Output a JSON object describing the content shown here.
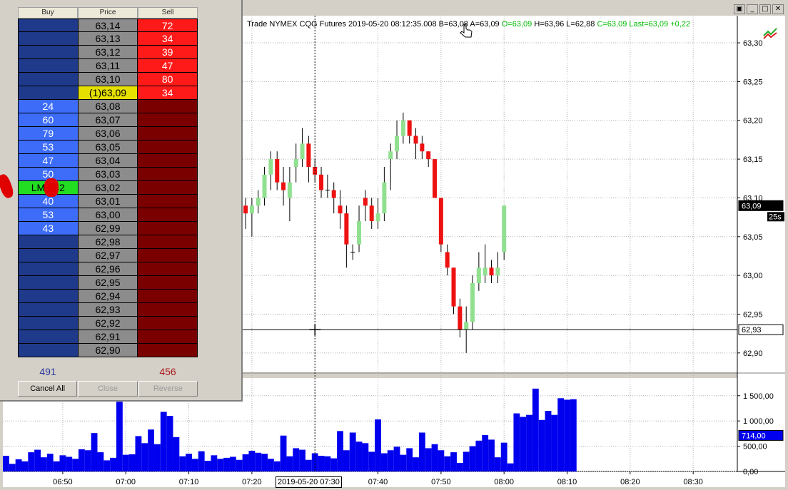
{
  "window": {
    "buttons": [
      {
        "name": "restore-icon",
        "glyph": "▣"
      },
      {
        "name": "minimize-icon",
        "glyph": "_"
      },
      {
        "name": "maximize-icon",
        "glyph": "□"
      },
      {
        "name": "close-icon",
        "glyph": "✕"
      }
    ]
  },
  "chart": {
    "info_prefix": "Trade  NYMEX  CQG  Futures  2019-05-20  08:12:35.008",
    "bid": "B=63,08",
    "ask": "A=63,09",
    "open": "O=63,09",
    "high": "H=63,96",
    "low": "L=62,88",
    "close": "C=63,09",
    "last": "Last=63,09",
    "change": "+0,22",
    "colors": {
      "up": "#90e090",
      "down": "#ee1111",
      "volume": "#0000ee",
      "label_bg": "#000000",
      "info_green": "#00bb00"
    },
    "price_ticks": [
      "63,30",
      "63,25",
      "63,20",
      "63,15",
      "63,10",
      "63,05",
      "63,00",
      "62,95",
      "62,90"
    ],
    "price_tick_values": [
      63.3,
      63.25,
      63.2,
      63.15,
      63.1,
      63.05,
      63.0,
      62.95,
      62.9
    ],
    "price_range": [
      62.875,
      63.335
    ],
    "last_label": "63,09",
    "last_value": 63.09,
    "timer_label": "25s",
    "cursor_label": "62,93",
    "cursor_value": 62.93,
    "volume_ticks": [
      "1 500,00",
      "1 000,00",
      "500,00",
      "0,00"
    ],
    "volume_tick_values": [
      1500,
      1000,
      500,
      0
    ],
    "volume_range": [
      0,
      1850
    ],
    "volume_label": "714,00",
    "volume_last": 714,
    "time_ticks": [
      "06:50",
      "07:00",
      "07:10",
      "07:20",
      "07:40",
      "07:50",
      "08:00",
      "08:10",
      "08:20",
      "08:30"
    ],
    "time_tick_minutes": [
      410,
      420,
      430,
      440,
      460,
      470,
      480,
      490,
      500,
      510
    ],
    "cursor_time_label": "2019-05-20 07:30",
    "cursor_time_minutes": 450,
    "time_range": [
      400.5,
      517
    ]
  },
  "chart_data": {
    "type": "bar",
    "x": [
      435,
      436,
      437,
      438,
      439,
      440,
      441,
      442,
      443,
      444,
      445,
      446,
      447,
      448,
      449,
      450,
      451,
      452,
      453,
      454,
      455,
      456,
      457,
      458,
      459,
      460,
      461,
      462,
      463,
      464,
      465,
      466,
      467,
      468,
      469,
      470,
      471,
      472,
      473,
      474,
      475,
      476,
      477,
      478,
      479,
      480,
      481,
      482,
      483,
      484,
      485,
      486,
      487,
      488,
      489,
      490,
      491
    ],
    "open": [
      63.14,
      63.2,
      63.12,
      63.1,
      63.09,
      63.08,
      63.09,
      63.1,
      63.13,
      63.15,
      63.12,
      63.1,
      63.14,
      63.15,
      63.17,
      63.14,
      63.13,
      63.11,
      63.11,
      63.09,
      63.08,
      63.03,
      63.04,
      63.1,
      63.09,
      63.07,
      63.08,
      63.15,
      63.16,
      63.18,
      63.2,
      63.18,
      63.17,
      63.16,
      63.15,
      63.1,
      63.03,
      63.01,
      62.96,
      62.93,
      62.94,
      62.99,
      63.0,
      63.01,
      63.0,
      63.03
    ],
    "close": [
      63.2,
      63.13,
      63.1,
      63.09,
      63.08,
      63.09,
      63.1,
      63.13,
      63.15,
      63.12,
      63.11,
      63.12,
      63.15,
      63.17,
      63.14,
      63.13,
      63.11,
      63.11,
      63.1,
      63.08,
      63.04,
      63.03,
      63.07,
      63.09,
      63.07,
      63.08,
      63.12,
      63.16,
      63.18,
      63.2,
      63.18,
      63.17,
      63.16,
      63.15,
      63.1,
      63.04,
      63.01,
      62.96,
      62.93,
      62.94,
      62.99,
      63.01,
      63.01,
      63.0,
      63.01,
      63.09
    ],
    "high": [
      63.23,
      63.23,
      63.14,
      63.12,
      63.1,
      63.1,
      63.11,
      63.14,
      63.16,
      63.16,
      63.14,
      63.14,
      63.17,
      63.19,
      63.18,
      63.15,
      63.14,
      63.13,
      63.12,
      63.11,
      63.09,
      63.04,
      63.09,
      63.11,
      63.1,
      63.1,
      63.14,
      63.17,
      63.2,
      63.21,
      63.2,
      63.19,
      63.18,
      63.16,
      63.15,
      63.1,
      63.04,
      63.01,
      62.97,
      62.96,
      63.0,
      63.03,
      63.04,
      63.02,
      63.03,
      63.09
    ],
    "low": [
      63.12,
      63.11,
      63.07,
      63.07,
      63.06,
      63.05,
      63.08,
      63.09,
      63.11,
      63.11,
      63.09,
      63.07,
      63.12,
      63.14,
      63.12,
      63.12,
      63.1,
      63.1,
      63.08,
      63.06,
      63.01,
      63.02,
      63.03,
      63.07,
      63.06,
      63.06,
      63.07,
      63.11,
      63.15,
      63.17,
      63.17,
      63.15,
      63.15,
      63.14,
      63.1,
      63.03,
      63.0,
      62.95,
      62.92,
      62.9,
      62.93,
      62.98,
      62.99,
      62.99,
      62.99,
      63.02
    ],
    "volume_x": [
      401,
      402,
      403,
      404,
      405,
      406,
      407,
      408,
      409,
      410,
      411,
      412,
      413,
      414,
      415,
      416,
      417,
      418,
      419,
      420,
      421,
      422,
      423,
      424,
      425,
      426,
      427,
      428,
      429,
      430,
      431,
      432,
      433,
      434,
      435,
      436,
      437,
      438,
      439,
      440,
      441,
      442,
      443,
      444,
      445,
      446,
      447,
      448,
      449,
      450,
      451,
      452,
      453,
      454,
      455,
      456,
      457,
      458,
      459,
      460,
      461,
      462,
      463,
      464,
      465,
      466,
      467,
      468,
      469,
      470,
      471,
      472,
      473,
      474,
      475,
      476,
      477,
      478,
      479,
      480,
      481,
      482,
      483,
      484,
      485,
      486,
      487,
      488,
      489,
      490,
      491
    ],
    "volume": [
      310,
      150,
      240,
      200,
      380,
      430,
      280,
      350,
      200,
      320,
      290,
      250,
      440,
      420,
      760,
      380,
      220,
      270,
      1380,
      330,
      340,
      700,
      560,
      830,
      540,
      1180,
      1100,
      680,
      300,
      350,
      250,
      400,
      210,
      320,
      250,
      270,
      290,
      230,
      340,
      410,
      370,
      350,
      250,
      200,
      710,
      300,
      460,
      430,
      230,
      360,
      310,
      300,
      260,
      800,
      420,
      770,
      590,
      560,
      390,
      1030,
      360,
      420,
      490,
      330,
      460,
      280,
      770,
      460,
      540,
      420,
      300,
      380,
      170,
      390,
      500,
      610,
      720,
      630,
      280,
      570,
      160,
      1150,
      1080,
      1120,
      1640,
      1020,
      1200,
      1120,
      1450,
      1420,
      1430,
      960,
      714
    ],
    "xlabel": "",
    "ylabel": ""
  },
  "dom": {
    "headers": {
      "buy": "Buy",
      "price": "Price",
      "sell": "Sell"
    },
    "rows": [
      {
        "buy": "",
        "price": "63,14",
        "sell": "72",
        "buy_hi": false,
        "sell_hi": true,
        "current": false
      },
      {
        "buy": "",
        "price": "63,13",
        "sell": "34",
        "buy_hi": false,
        "sell_hi": true,
        "current": false
      },
      {
        "buy": "",
        "price": "63,12",
        "sell": "39",
        "buy_hi": false,
        "sell_hi": true,
        "current": false
      },
      {
        "buy": "",
        "price": "63,11",
        "sell": "47",
        "buy_hi": false,
        "sell_hi": true,
        "current": false
      },
      {
        "buy": "",
        "price": "63,10",
        "sell": "80",
        "buy_hi": false,
        "sell_hi": true,
        "current": false
      },
      {
        "buy": "",
        "price": "(1)63,09",
        "sell": "34",
        "buy_hi": false,
        "sell_hi": true,
        "current": true
      },
      {
        "buy": "24",
        "price": "63,08",
        "sell": "",
        "buy_hi": true,
        "sell_hi": false,
        "current": false
      },
      {
        "buy": "60",
        "price": "63,07",
        "sell": "",
        "buy_hi": true,
        "sell_hi": false,
        "current": false
      },
      {
        "buy": "79",
        "price": "63,06",
        "sell": "",
        "buy_hi": true,
        "sell_hi": false,
        "current": false
      },
      {
        "buy": "53",
        "price": "63,05",
        "sell": "",
        "buy_hi": true,
        "sell_hi": false,
        "current": false
      },
      {
        "buy": "47",
        "price": "63,04",
        "sell": "",
        "buy_hi": true,
        "sell_hi": false,
        "current": false
      },
      {
        "buy": "50",
        "price": "63,03",
        "sell": "",
        "buy_hi": true,
        "sell_hi": false,
        "current": false
      },
      {
        "buy": "LMT 42",
        "price": "63,02",
        "sell": "",
        "buy_hi": true,
        "sell_hi": false,
        "current": false,
        "lmt": true
      },
      {
        "buy": "40",
        "price": "63,01",
        "sell": "",
        "buy_hi": true,
        "sell_hi": false,
        "current": false
      },
      {
        "buy": "53",
        "price": "63,00",
        "sell": "",
        "buy_hi": true,
        "sell_hi": false,
        "current": false
      },
      {
        "buy": "43",
        "price": "62,99",
        "sell": "",
        "buy_hi": true,
        "sell_hi": false,
        "current": false
      },
      {
        "buy": "",
        "price": "62,98",
        "sell": "",
        "buy_hi": false,
        "sell_hi": false,
        "current": false
      },
      {
        "buy": "",
        "price": "62,97",
        "sell": "",
        "buy_hi": false,
        "sell_hi": false,
        "current": false
      },
      {
        "buy": "",
        "price": "62,96",
        "sell": "",
        "buy_hi": false,
        "sell_hi": false,
        "current": false
      },
      {
        "buy": "",
        "price": "62,95",
        "sell": "",
        "buy_hi": false,
        "sell_hi": false,
        "current": false
      },
      {
        "buy": "",
        "price": "62,94",
        "sell": "",
        "buy_hi": false,
        "sell_hi": false,
        "current": false
      },
      {
        "buy": "",
        "price": "62,93",
        "sell": "",
        "buy_hi": false,
        "sell_hi": false,
        "current": false
      },
      {
        "buy": "",
        "price": "62,92",
        "sell": "",
        "buy_hi": false,
        "sell_hi": false,
        "current": false
      },
      {
        "buy": "",
        "price": "62,91",
        "sell": "",
        "buy_hi": false,
        "sell_hi": false,
        "current": false
      },
      {
        "buy": "",
        "price": "62,90",
        "sell": "",
        "buy_hi": false,
        "sell_hi": false,
        "current": false
      }
    ],
    "total_buy": "491",
    "total_sell": "456",
    "total_buy_color": "#2a3a9a",
    "total_sell_color": "#aa1a1a",
    "buttons": {
      "cancel_all": "Cancel All",
      "close": "Close",
      "reverse": "Reverse"
    }
  }
}
